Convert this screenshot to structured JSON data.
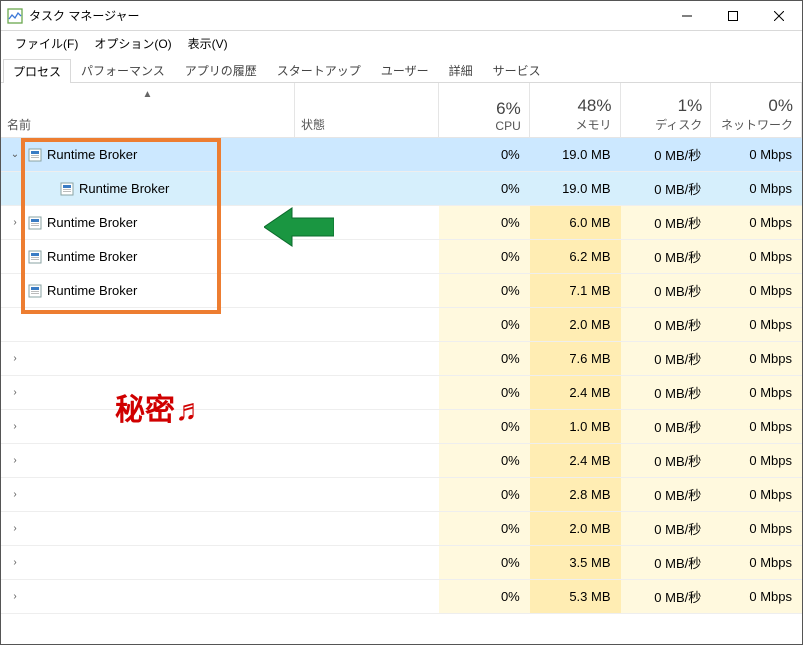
{
  "window": {
    "title": "タスク マネージャー"
  },
  "menu": {
    "file": "ファイル(F)",
    "options": "オプション(O)",
    "view": "表示(V)"
  },
  "tabs": [
    {
      "label": "プロセス",
      "active": true
    },
    {
      "label": "パフォーマンス",
      "active": false
    },
    {
      "label": "アプリの履歴",
      "active": false
    },
    {
      "label": "スタートアップ",
      "active": false
    },
    {
      "label": "ユーザー",
      "active": false
    },
    {
      "label": "詳細",
      "active": false
    },
    {
      "label": "サービス",
      "active": false
    }
  ],
  "columns": {
    "name": "名前",
    "status": "状態",
    "cpu": {
      "pct": "6%",
      "label": "CPU"
    },
    "mem": {
      "pct": "48%",
      "label": "メモリ"
    },
    "disk": {
      "pct": "1%",
      "label": "ディスク"
    },
    "net": {
      "pct": "0%",
      "label": "ネットワーク"
    }
  },
  "rows": [
    {
      "expander": "open",
      "indent": 0,
      "icon": "proc",
      "name": "Runtime Broker",
      "cpu": "0%",
      "mem": "19.0 MB",
      "disk": "0 MB/秒",
      "net": "0 Mbps",
      "selected": true,
      "child": false
    },
    {
      "expander": "",
      "indent": 28,
      "icon": "proc",
      "name": "Runtime Broker",
      "cpu": "0%",
      "mem": "19.0 MB",
      "disk": "0 MB/秒",
      "net": "0 Mbps",
      "selected": true,
      "child": true
    },
    {
      "expander": "close",
      "indent": 0,
      "icon": "proc",
      "name": "Runtime Broker",
      "cpu": "0%",
      "mem": "6.0 MB",
      "disk": "0 MB/秒",
      "net": "0 Mbps",
      "selected": false,
      "child": false
    },
    {
      "expander": "",
      "indent": 0,
      "icon": "proc",
      "name": "Runtime Broker",
      "cpu": "0%",
      "mem": "6.2 MB",
      "disk": "0 MB/秒",
      "net": "0 Mbps",
      "selected": false,
      "child": false
    },
    {
      "expander": "",
      "indent": 0,
      "icon": "proc",
      "name": "Runtime Broker",
      "cpu": "0%",
      "mem": "7.1 MB",
      "disk": "0 MB/秒",
      "net": "0 Mbps",
      "selected": false,
      "child": false
    },
    {
      "expander": "",
      "indent": 0,
      "icon": "",
      "name": "",
      "cpu": "0%",
      "mem": "2.0 MB",
      "disk": "0 MB/秒",
      "net": "0 Mbps",
      "selected": false,
      "child": false
    },
    {
      "expander": "close",
      "indent": 0,
      "icon": "",
      "name": "",
      "cpu": "0%",
      "mem": "7.6 MB",
      "disk": "0 MB/秒",
      "net": "0 Mbps",
      "selected": false,
      "child": false
    },
    {
      "expander": "close",
      "indent": 0,
      "icon": "",
      "name": "",
      "cpu": "0%",
      "mem": "2.4 MB",
      "disk": "0 MB/秒",
      "net": "0 Mbps",
      "selected": false,
      "child": false
    },
    {
      "expander": "close",
      "indent": 0,
      "icon": "",
      "name": "",
      "cpu": "0%",
      "mem": "1.0 MB",
      "disk": "0 MB/秒",
      "net": "0 Mbps",
      "selected": false,
      "child": false
    },
    {
      "expander": "close",
      "indent": 0,
      "icon": "",
      "name": "",
      "cpu": "0%",
      "mem": "2.4 MB",
      "disk": "0 MB/秒",
      "net": "0 Mbps",
      "selected": false,
      "child": false
    },
    {
      "expander": "close",
      "indent": 0,
      "icon": "",
      "name": "",
      "cpu": "0%",
      "mem": "2.8 MB",
      "disk": "0 MB/秒",
      "net": "0 Mbps",
      "selected": false,
      "child": false
    },
    {
      "expander": "close",
      "indent": 0,
      "icon": "",
      "name": "",
      "cpu": "0%",
      "mem": "2.0 MB",
      "disk": "0 MB/秒",
      "net": "0 Mbps",
      "selected": false,
      "child": false
    },
    {
      "expander": "close",
      "indent": 0,
      "icon": "",
      "name": "",
      "cpu": "0%",
      "mem": "3.5 MB",
      "disk": "0 MB/秒",
      "net": "0 Mbps",
      "selected": false,
      "child": false
    },
    {
      "expander": "close",
      "indent": 0,
      "icon": "",
      "name": "",
      "cpu": "0%",
      "mem": "5.3 MB",
      "disk": "0 MB/秒",
      "net": "0 Mbps",
      "selected": false,
      "child": false
    }
  ],
  "annotations": {
    "secret": "秘密♬"
  }
}
